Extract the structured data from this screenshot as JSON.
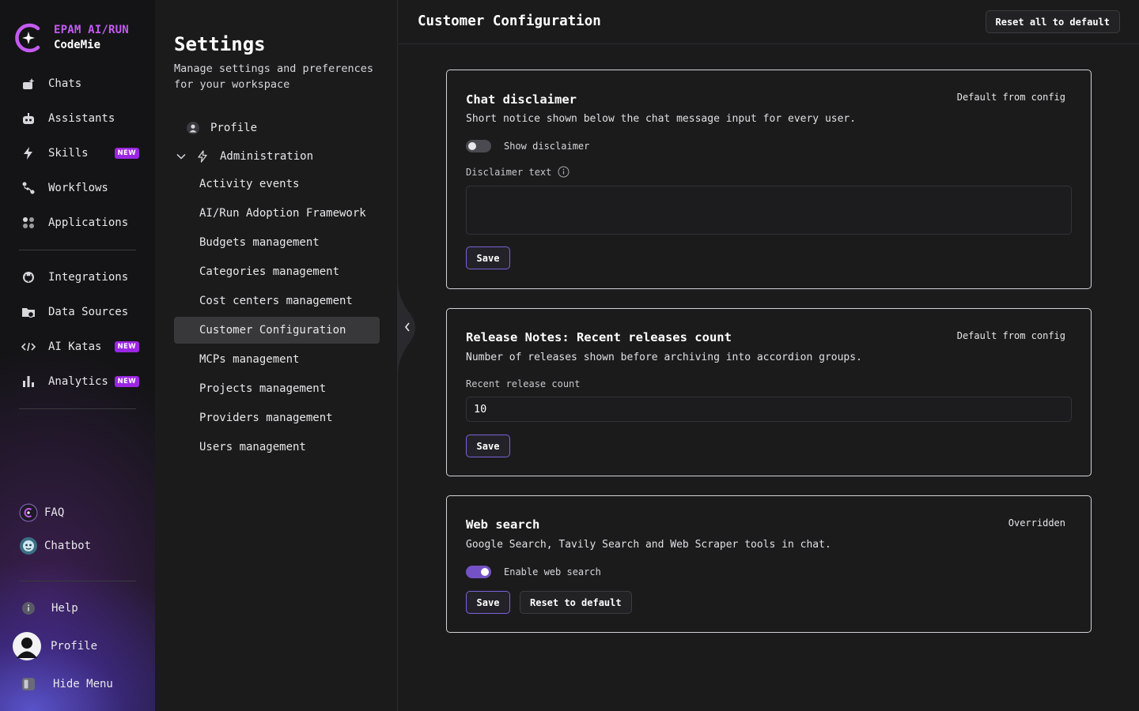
{
  "brand": {
    "line1": "EPAM AI/RUN",
    "line2": "CodeMie",
    "accent": "#c45bf2"
  },
  "nav": {
    "items": [
      {
        "label": "Chats",
        "icon": "chats-icon"
      },
      {
        "label": "Assistants",
        "icon": "robot-icon"
      },
      {
        "label": "Skills",
        "icon": "lightning-icon",
        "badge": "NEW"
      },
      {
        "label": "Workflows",
        "icon": "workflow-icon"
      },
      {
        "label": "Applications",
        "icon": "apps-grid-icon"
      },
      {
        "label": "Integrations",
        "icon": "integrations-icon"
      },
      {
        "label": "Data Sources",
        "icon": "data-sources-icon"
      },
      {
        "label": "AI Katas",
        "icon": "code-icon",
        "badge": "NEW"
      },
      {
        "label": "Analytics",
        "icon": "bar-chart-icon",
        "badge": "NEW"
      }
    ],
    "faq": "FAQ",
    "chatbot": "Chatbot",
    "help": "Help",
    "profile": "Profile",
    "hide_menu": "Hide Menu",
    "badge_color": "#9b26e4"
  },
  "settings": {
    "title": "Settings",
    "subtitle": "Manage settings and preferences for your workspace",
    "profile": "Profile",
    "administration": "Administration",
    "sub_items": [
      "Activity events",
      "AI/Run Adoption Framework",
      "Budgets management",
      "Categories management",
      "Cost centers management",
      "Customer Configuration",
      "MCPs management",
      "Projects management",
      "Providers management",
      "Users management"
    ],
    "active": "Customer Configuration"
  },
  "main": {
    "title": "Customer Configuration",
    "reset_all": "Reset all to default",
    "cards": {
      "disclaimer": {
        "title": "Chat disclaimer",
        "status": "Default from config",
        "description": "Short notice shown below the chat message input for every user.",
        "toggle_label": "Show disclaimer",
        "toggle_on": false,
        "field_label": "Disclaimer text",
        "field_value": "",
        "save": "Save"
      },
      "release_notes": {
        "title": "Release Notes: Recent releases count",
        "status": "Default from config",
        "description": "Number of releases shown before archiving into accordion groups.",
        "field_label": "Recent release count",
        "field_value": "10",
        "save": "Save"
      },
      "web_search": {
        "title": "Web search",
        "status": "Overridden",
        "description": "Google Search, Tavily Search and Web Scraper tools in chat.",
        "toggle_label": "Enable web search",
        "toggle_on": true,
        "save": "Save",
        "reset": "Reset to default"
      }
    },
    "accent": "#7c62d8"
  }
}
